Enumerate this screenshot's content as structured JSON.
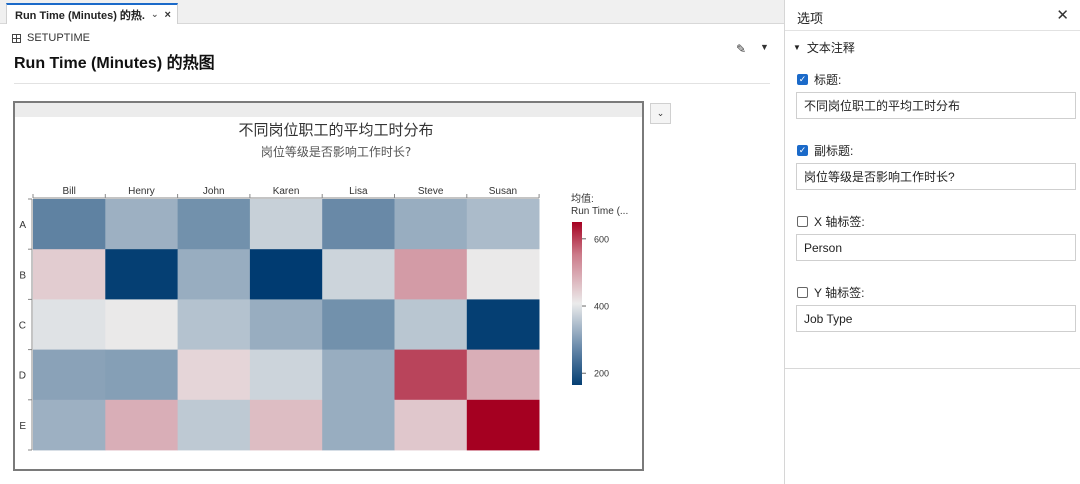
{
  "tab": {
    "label": "Run Time (Minutes) 的热...",
    "chevron": "⌄",
    "close": "×"
  },
  "breadcrumb": {
    "text": "SETUPTIME"
  },
  "page_title": "Run Time (Minutes) 的热图",
  "icons": {
    "edit": "✎",
    "more": "▼",
    "dropdown": "⌄",
    "panel_close": "✕",
    "section_caret": "▼",
    "check": "✓"
  },
  "colors": {
    "low": "#053f73",
    "mid": "#ebebeb",
    "high": "#a50021",
    "accent": "#1b6ac9"
  },
  "chart_data": {
    "type": "heatmap",
    "title": "不同岗位职工的平均工时分布",
    "subtitle": "岗位等级是否影响工作时长?",
    "x_categories": [
      "Bill",
      "Henry",
      "John",
      "Karen",
      "Lisa",
      "Steve",
      "Susan"
    ],
    "y_categories": [
      "A",
      "B",
      "C",
      "D",
      "E"
    ],
    "values": [
      [
        260,
        325,
        280,
        370,
        270,
        320,
        340
      ],
      [
        440,
        165,
        320,
        160,
        375,
        490,
        410
      ],
      [
        395,
        410,
        350,
        320,
        280,
        355,
        165
      ],
      [
        305,
        300,
        430,
        375,
        320,
        580,
        470
      ],
      [
        325,
        470,
        360,
        455,
        320,
        445,
        650
      ]
    ],
    "legend": {
      "title_line1": "均值:",
      "title_line2": "Run Time (...",
      "ticks": [
        200,
        400,
        600
      ],
      "range": [
        165,
        650
      ]
    }
  },
  "options": {
    "title": "选项",
    "section": "文本注释",
    "fields": [
      {
        "label": "标题:",
        "checked": true,
        "value": "不同岗位职工的平均工时分布"
      },
      {
        "label": "副标题:",
        "checked": true,
        "value": "岗位等级是否影响工作时长?"
      },
      {
        "label": "X 轴标签:",
        "checked": false,
        "value": "Person"
      },
      {
        "label": "Y 轴标签:",
        "checked": false,
        "value": "Job Type"
      }
    ]
  }
}
